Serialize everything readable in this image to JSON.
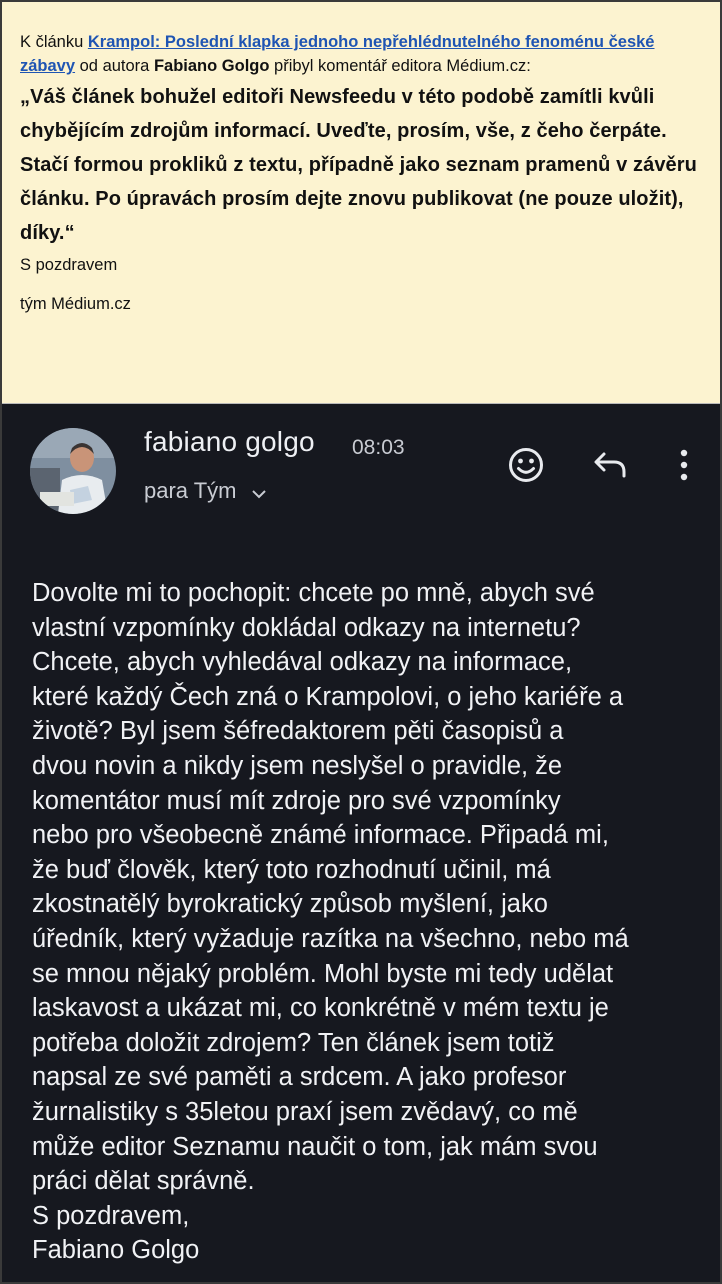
{
  "notice": {
    "prefix": "K článku ",
    "article_link": "Krampol: Poslední klapka jednoho nepřehlédnutelného fenoménu české zábavy",
    "middle": " od autora ",
    "author": "Fabiano Golgo",
    "suffix": " přibyl komentář editora Médium.cz:",
    "quote": "„Váš článek bohužel editoři Newsfeedu v této podobě zamítli kvůli chybějícím zdrojům informací. Uveďte, prosím, vše, z čeho čerpáte. Stačí formou prokliků z textu, případně jako seznam pramenů v závěru článku. Po úpravách prosím dejte znovu publikovat (ne pouze uložit), díky.“",
    "greeting": "S pozdravem",
    "team": "tým Médium.cz"
  },
  "email": {
    "sender": "fabiano golgo",
    "time": "08:03",
    "recipient": "para Tým",
    "icons": [
      "emoji-icon",
      "reply-icon",
      "more-icon"
    ],
    "body": "Dovolte mi to pochopit: chcete po mně, abych své\nvlastní vzpomínky dokládal odkazy na internetu?\nChcete, abych vyhledával odkazy na informace,\nkteré každý Čech zná o Krampolovi, o jeho kariéře a\nživotě? Byl jsem šéfredaktorem pěti časopisů a\ndvou novin a nikdy jsem neslyšel o pravidle, že\nkomentátor musí mít zdroje pro své vzpomínky\nnebo pro všeobecně známé informace. Připadá mi,\nže buď člověk, který toto rozhodnutí učinil, má\nzkostnatělý byrokratický způsob myšlení, jako\núředník, který vyžaduje razítka na všechno, nebo má\nse mnou nějaký problém. Mohl byste mi tedy udělat\nlaskavost a ukázat mi, co konkrétně v mém textu je\npotřeba doložit zdrojem? Ten článek jsem totiž\nnapsal ze své paměti a srdcem. A jako profesor\nžurnalistiky s 35letou praxí jsem zvědavý, co mě\nmůže editor Seznamu naučit o tom, jak mám svou\npráci dělat správně.\nS pozdravem,\nFabiano Golgo"
  },
  "colors": {
    "notice_bg": "#fcf3d0",
    "link": "#1f55b3",
    "email_bg": "#16181f"
  }
}
